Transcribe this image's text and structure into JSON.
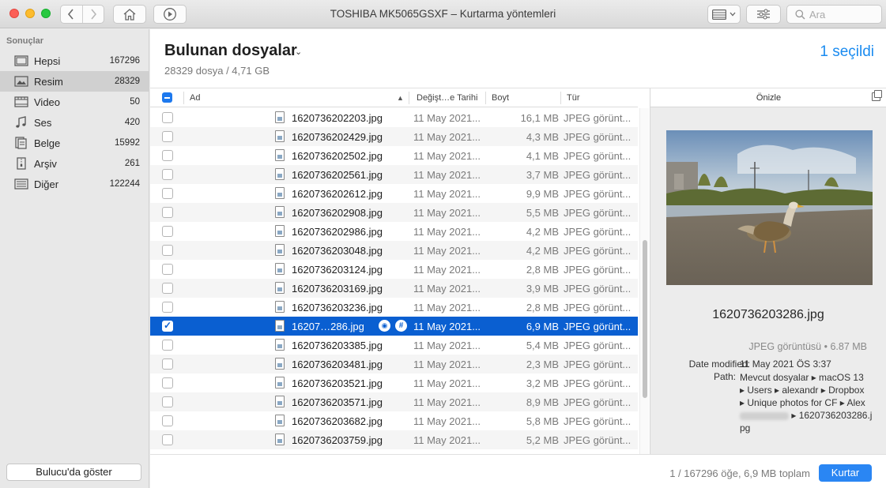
{
  "window": {
    "title": "TOSHIBA MK5065GSXF – Kurtarma yöntemleri"
  },
  "toolbar": {
    "search_placeholder": "Ara"
  },
  "sidebar": {
    "heading": "Sonuçlar",
    "items": [
      {
        "label": "Hepsi",
        "count": "167296",
        "icon": "all-files-icon"
      },
      {
        "label": "Resim",
        "count": "28329",
        "icon": "image-icon",
        "selected": true
      },
      {
        "label": "Video",
        "count": "50",
        "icon": "video-icon"
      },
      {
        "label": "Ses",
        "count": "420",
        "icon": "music-icon"
      },
      {
        "label": "Belge",
        "count": "15992",
        "icon": "document-icon"
      },
      {
        "label": "Arşiv",
        "count": "261",
        "icon": "archive-icon"
      },
      {
        "label": "Diğer",
        "count": "122244",
        "icon": "other-icon"
      }
    ],
    "finder_button": "Bulucu'da göster"
  },
  "header": {
    "title": "Bulunan dosyalar",
    "subtitle": "28329 dosya / 4,71 GB",
    "selected_count": "1 seçildi"
  },
  "table": {
    "columns": {
      "name": "Ad",
      "date": "Değişt…e Tarihi",
      "size": "Boyt",
      "type": "Tür"
    },
    "rows": [
      {
        "name": "1620736202203.jpg",
        "date": "11 May 2021...",
        "size": "16,1 MB",
        "type": "JPEG görünt..."
      },
      {
        "name": "1620736202429.jpg",
        "date": "11 May 2021...",
        "size": "4,3 MB",
        "type": "JPEG görünt..."
      },
      {
        "name": "1620736202502.jpg",
        "date": "11 May 2021...",
        "size": "4,1 MB",
        "type": "JPEG görünt..."
      },
      {
        "name": "1620736202561.jpg",
        "date": "11 May 2021...",
        "size": "3,7 MB",
        "type": "JPEG görünt..."
      },
      {
        "name": "1620736202612.jpg",
        "date": "11 May 2021...",
        "size": "9,9 MB",
        "type": "JPEG görünt..."
      },
      {
        "name": "1620736202908.jpg",
        "date": "11 May 2021...",
        "size": "5,5 MB",
        "type": "JPEG görünt..."
      },
      {
        "name": "1620736202986.jpg",
        "date": "11 May 2021...",
        "size": "4,2 MB",
        "type": "JPEG görünt..."
      },
      {
        "name": "1620736203048.jpg",
        "date": "11 May 2021...",
        "size": "4,2 MB",
        "type": "JPEG görünt..."
      },
      {
        "name": "1620736203124.jpg",
        "date": "11 May 2021...",
        "size": "2,8 MB",
        "type": "JPEG görünt..."
      },
      {
        "name": "1620736203169.jpg",
        "date": "11 May 2021...",
        "size": "3,9 MB",
        "type": "JPEG görünt..."
      },
      {
        "name": "1620736203236.jpg",
        "date": "11 May 2021...",
        "size": "2,8 MB",
        "type": "JPEG görünt..."
      },
      {
        "name": "16207…286.jpg",
        "date": "11 May 2021...",
        "size": "6,9 MB",
        "type": "JPEG görünt...",
        "selected": true
      },
      {
        "name": "1620736203385.jpg",
        "date": "11 May 2021...",
        "size": "5,4 MB",
        "type": "JPEG görünt..."
      },
      {
        "name": "1620736203481.jpg",
        "date": "11 May 2021...",
        "size": "2,3 MB",
        "type": "JPEG görünt..."
      },
      {
        "name": "1620736203521.jpg",
        "date": "11 May 2021...",
        "size": "3,2 MB",
        "type": "JPEG görünt..."
      },
      {
        "name": "1620736203571.jpg",
        "date": "11 May 2021...",
        "size": "8,9 MB",
        "type": "JPEG görünt..."
      },
      {
        "name": "1620736203682.jpg",
        "date": "11 May 2021...",
        "size": "5,8 MB",
        "type": "JPEG görünt..."
      },
      {
        "name": "1620736203759.jpg",
        "date": "11 May 2021...",
        "size": "5,2 MB",
        "type": "JPEG görünt..."
      }
    ]
  },
  "preview": {
    "title": "Önizle",
    "filename": "1620736203286.jpg",
    "type_size": "JPEG görüntüsü • 6.87 MB",
    "date_key": "Date modified:",
    "date_value": "11 May 2021 ÖS 3:37",
    "path_key": "Path:",
    "path_lines": [
      "Mevcut dosyalar ▸ macOS 13",
      "▸ Users ▸ alexandr ▸ Dropbox",
      "▸ Unique photos for CF ▸ Alex"
    ],
    "path_tail": "▸ 1620736203286.j",
    "path_end": "pg"
  },
  "footer": {
    "status": "1 / 167296 öğe, 6,9 MB toplam",
    "recover_button": "Kurtar"
  },
  "colors": {
    "accent": "#1a8bf0",
    "selection": "#0a5fd1",
    "button_blue": "#2a86f3"
  }
}
